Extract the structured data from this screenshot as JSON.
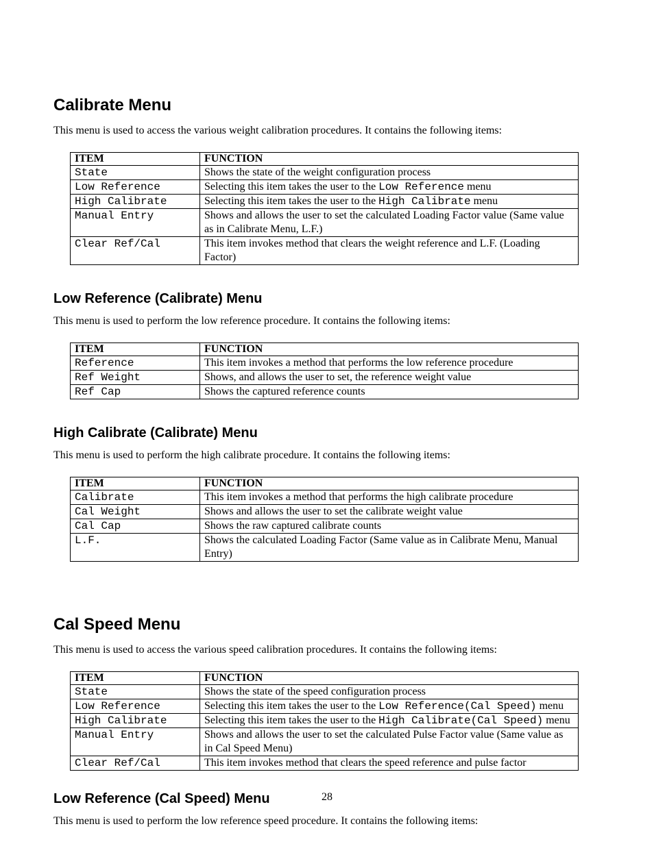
{
  "page_number": "28",
  "sections": [
    {
      "heading": "Calibrate Menu",
      "level": 1,
      "intro": "This menu is used to access the various weight calibration procedures.  It contains the following items:",
      "table": {
        "headers": [
          "ITEM",
          "FUNCTION"
        ],
        "rows": [
          {
            "item": "State",
            "function_parts": [
              "Shows the state of the weight configuration process"
            ]
          },
          {
            "item": "Low Reference",
            "function_parts": [
              "Selecting this item takes the user to the ",
              {
                "mono": "Low Reference"
              },
              " menu"
            ]
          },
          {
            "item": "High Calibrate",
            "function_parts": [
              "Selecting this item takes the user to the ",
              {
                "mono": "High Calibrate"
              },
              " menu"
            ]
          },
          {
            "item": "Manual Entry",
            "function_parts": [
              "Shows and allows the user to set the calculated Loading Factor value (Same value as in Calibrate Menu, L.F.)"
            ]
          },
          {
            "item": "Clear Ref/Cal",
            "function_parts": [
              "This item invokes method that clears the weight reference and L.F. (Loading Factor)"
            ]
          }
        ]
      }
    },
    {
      "heading": "Low Reference (Calibrate) Menu",
      "level": 2,
      "intro": "This menu is used to perform the low reference procedure.  It contains the following items:",
      "table": {
        "headers": [
          "ITEM",
          "FUNCTION"
        ],
        "rows": [
          {
            "item": "Reference",
            "function_parts": [
              "This item invokes a method that performs the low reference procedure"
            ]
          },
          {
            "item": "Ref Weight",
            "function_parts": [
              "Shows, and allows the user to set,  the reference weight value"
            ]
          },
          {
            "item": "Ref Cap",
            "function_parts": [
              "Shows the captured reference counts"
            ]
          }
        ]
      }
    },
    {
      "heading": "High Calibrate (Calibrate) Menu",
      "level": 2,
      "intro": "This menu is used to perform the high calibrate procedure.  It contains the following items:",
      "table": {
        "headers": [
          "ITEM",
          "FUNCTION"
        ],
        "rows": [
          {
            "item": "Calibrate",
            "function_parts": [
              "This item invokes a method that performs the high calibrate procedure"
            ]
          },
          {
            "item": "Cal Weight",
            "function_parts": [
              "Shows and allows the user to set the calibrate weight value"
            ]
          },
          {
            "item": "Cal Cap",
            "function_parts": [
              "Shows the raw captured calibrate counts"
            ]
          },
          {
            "item": "L.F.",
            "function_parts": [
              "Shows the calculated Loading Factor (Same value as in Calibrate Menu, Manual Entry)"
            ]
          }
        ]
      }
    },
    {
      "heading": "Cal Speed Menu",
      "level": 1,
      "intro": "This menu is used to access the various speed calibration procedures.  It contains the following items:",
      "table": {
        "headers": [
          "ITEM",
          "FUNCTION"
        ],
        "rows": [
          {
            "item": "State",
            "function_parts": [
              "Shows the state of the speed configuration process"
            ]
          },
          {
            "item": "Low Reference",
            "function_parts": [
              "Selecting this item takes the user to the ",
              {
                "mono": "Low Reference(Cal Speed)"
              },
              " menu"
            ]
          },
          {
            "item": "High Calibrate",
            "function_parts": [
              "Selecting this item takes the user to the ",
              {
                "mono": "High Calibrate(Cal Speed)"
              },
              " menu"
            ]
          },
          {
            "item": "Manual Entry",
            "function_parts": [
              "Shows and allows the user to set the calculated Pulse Factor value (Same value as in Cal Speed Menu)"
            ]
          },
          {
            "item": "Clear Ref/Cal",
            "function_parts": [
              "This item invokes method that clears the speed reference and pulse factor"
            ]
          }
        ]
      }
    },
    {
      "heading": "Low Reference (Cal Speed) Menu",
      "level": 2,
      "intro": "This menu is used to perform the low reference speed procedure.  It contains the following items:",
      "table": null
    }
  ]
}
